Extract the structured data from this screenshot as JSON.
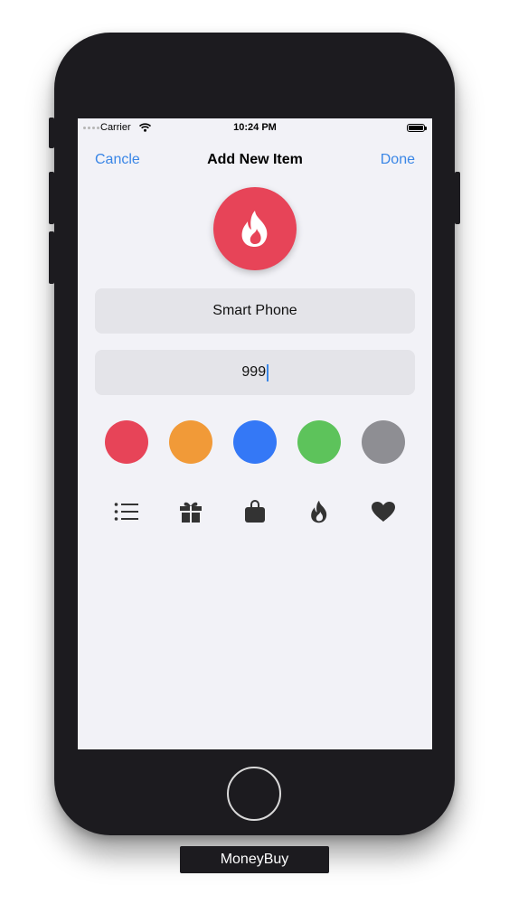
{
  "status_bar": {
    "carrier": "Carrier",
    "time": "10:24 PM"
  },
  "nav": {
    "cancel_label": "Cancle",
    "title": "Add New Item",
    "done_label": "Done"
  },
  "hero": {
    "icon": "flame-icon",
    "color": "#e74458"
  },
  "fields": {
    "name_value": "Smart Phone",
    "price_value": "999"
  },
  "color_options": [
    {
      "name": "red",
      "hex": "#e74458"
    },
    {
      "name": "orange",
      "hex": "#f19a38"
    },
    {
      "name": "blue",
      "hex": "#3478f6"
    },
    {
      "name": "green",
      "hex": "#5dc35b"
    },
    {
      "name": "gray",
      "hex": "#8e8e93"
    }
  ],
  "icon_options": [
    "list-icon",
    "gift-icon",
    "bag-icon",
    "flame-icon",
    "heart-icon"
  ],
  "caption": "MoneyBuy"
}
